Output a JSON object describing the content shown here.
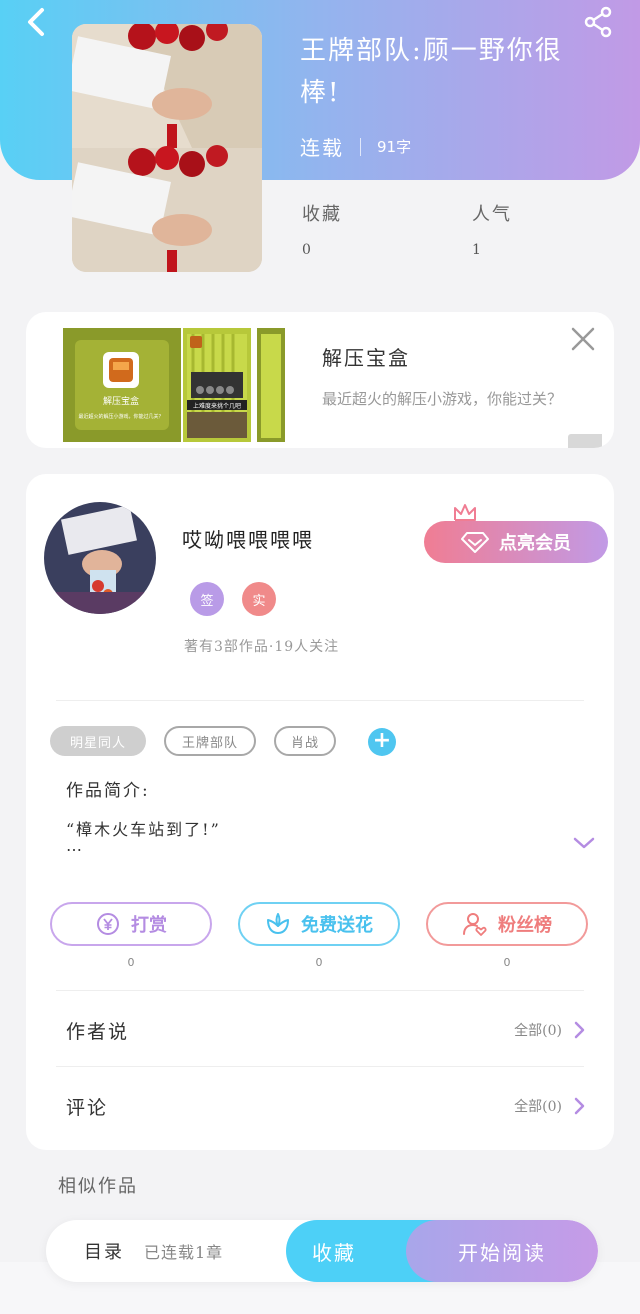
{
  "book": {
    "title": "王牌部队:顾一野你很棒!",
    "status": "连载",
    "words": "91字",
    "stats": [
      {
        "label": "收藏",
        "value": "0"
      },
      {
        "label": "人气",
        "value": "1"
      }
    ]
  },
  "ad": {
    "title": "解压宝盒",
    "description": "最近超火的解压小游戏，你能过关？",
    "image_text_1": "解压宝盒",
    "image_text_2": "最近超火的解压小游戏，你能过几关？",
    "image_text_3": "上难度来挑个几吧"
  },
  "author": {
    "name": "哎呦喂喂喂喂",
    "badge_sign": "签",
    "badge_real": "实",
    "stats": "著有3部作品·19人关注",
    "vip_button": "点亮会员"
  },
  "tags": [
    "明星同人",
    "王牌部队",
    "肖战"
  ],
  "tag_add": "+",
  "intro": {
    "label": "作品简介:",
    "text": "“樟木火车站到了!”",
    "more": "…"
  },
  "actions": [
    {
      "label": "打赏",
      "count": "0"
    },
    {
      "label": "免费送花",
      "count": "0"
    },
    {
      "label": "粉丝榜",
      "count": "0"
    }
  ],
  "rows": [
    {
      "title": "作者说",
      "right": "全部(0)"
    },
    {
      "title": "评论",
      "right": "全部(0)"
    }
  ],
  "similar_label": "相似作品",
  "bottom": {
    "toc_label": "目录",
    "toc_chapters": "已连载1章",
    "collect": "收藏",
    "read": "开始阅读"
  },
  "colors": {
    "header_start": "#58d0f5",
    "header_end": "#c19ae6",
    "accent_blue": "#4dd0f7",
    "accent_purple": "#c19ae6",
    "accent_pink": "#f07d93"
  },
  "icons": [
    "back-arrow-icon",
    "share-icon",
    "close-icon",
    "crown-icon",
    "diamond-icon",
    "plus-icon",
    "chevron-down-icon",
    "yen-icon",
    "flower-icon",
    "user-heart-icon",
    "chevron-right-icon"
  ]
}
